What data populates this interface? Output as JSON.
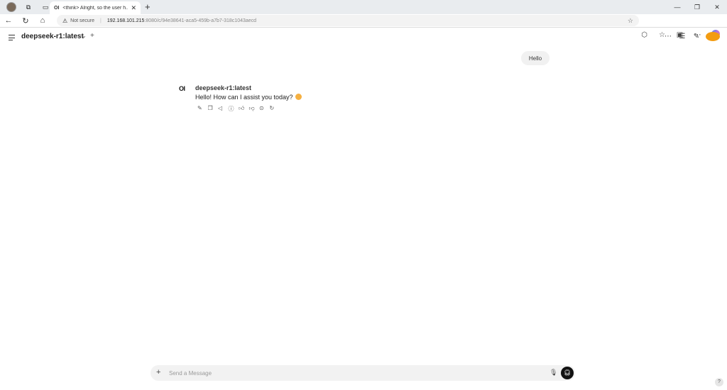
{
  "browser": {
    "tab_title": "<think> Alright, so the user h...",
    "tab_favicon": "OI",
    "url_warning": "Not secure",
    "url_host": "192.168.101.215",
    "url_path": ":8080/c/94e38641-aca5-459b-a7b7-318c1043aecd"
  },
  "header": {
    "model_name": "deepseek-r1:latest",
    "accent_color": "#f39c12"
  },
  "chat": {
    "user_message": "Hello",
    "bot_logo": "OI",
    "bot_name": "deepseek-r1:latest",
    "bot_message": "Hello! How can I assist you today?",
    "action_icons": [
      "edit-icon",
      "copy-icon",
      "speaker-icon",
      "info-icon",
      "thumbs-up-icon",
      "thumbs-down-icon",
      "continue-icon",
      "regenerate-icon"
    ]
  },
  "composer": {
    "placeholder": "Send a Message"
  },
  "help_label": "?"
}
